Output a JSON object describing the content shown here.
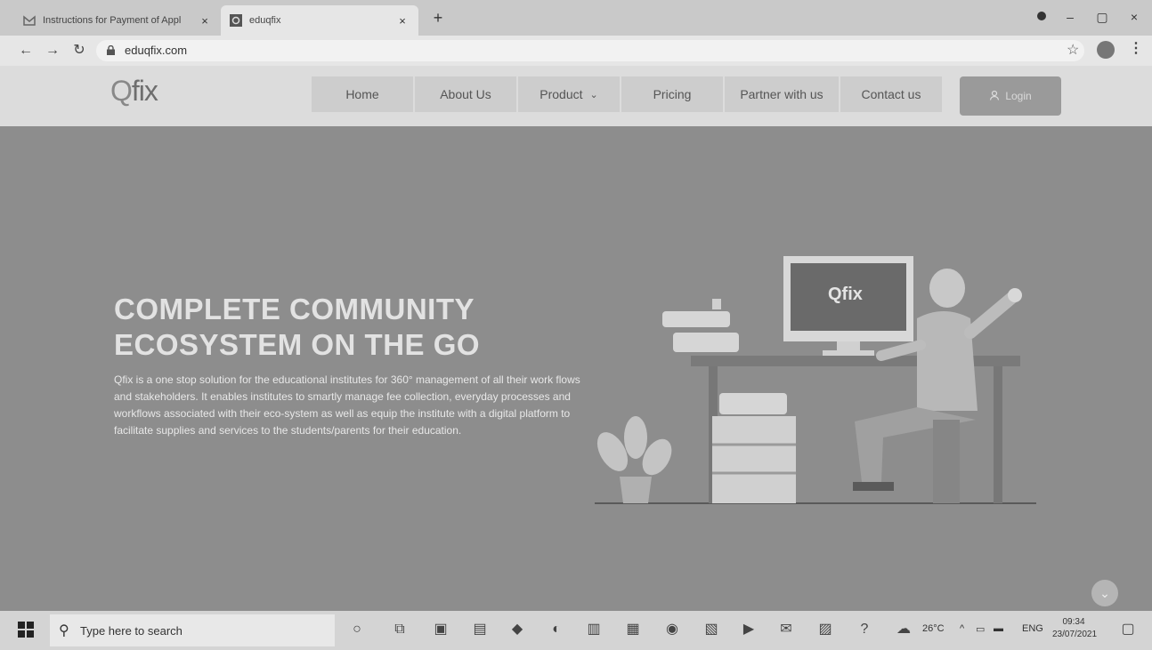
{
  "browser": {
    "tabs": [
      {
        "title": "Instructions for Payment of Appl",
        "active": false,
        "favicon": "gmail-icon"
      },
      {
        "title": "eduqfix",
        "active": true,
        "favicon": "qfix-icon"
      }
    ],
    "new_tab": "+",
    "url": "eduqfix.com",
    "window_controls": [
      "minimize",
      "maximize",
      "close"
    ]
  },
  "site": {
    "logo": {
      "q": "Q",
      "rest": "fix"
    },
    "nav": [
      "Home",
      "About Us",
      "Product",
      "Pricing",
      "Partner with us",
      "Contact us"
    ],
    "login_label": "Login"
  },
  "hero": {
    "headline_line1": "COMPLETE COMMUNITY",
    "headline_line2": "ECOSYSTEM ON THE GO",
    "description": "Qfix is a one stop solution for the educational institutes for 360° management of all their work flows and stakeholders. It enables institutes to smartly manage fee collection, everyday processes and workflows associated with their eco-system as well as equip the institute with a digital platform to facilitate supplies and services to the students/parents for their education.",
    "monitor_logo": "Qfix"
  },
  "taskbar": {
    "search_placeholder": "Type here to search",
    "weather": "26°C",
    "language": "ENG",
    "time": "09:34",
    "date": "23/07/2021"
  },
  "colors": {
    "hero_bg": "#8d8d8d",
    "header_bg": "#dcdcdc",
    "login_bg": "#9a9a9a"
  }
}
